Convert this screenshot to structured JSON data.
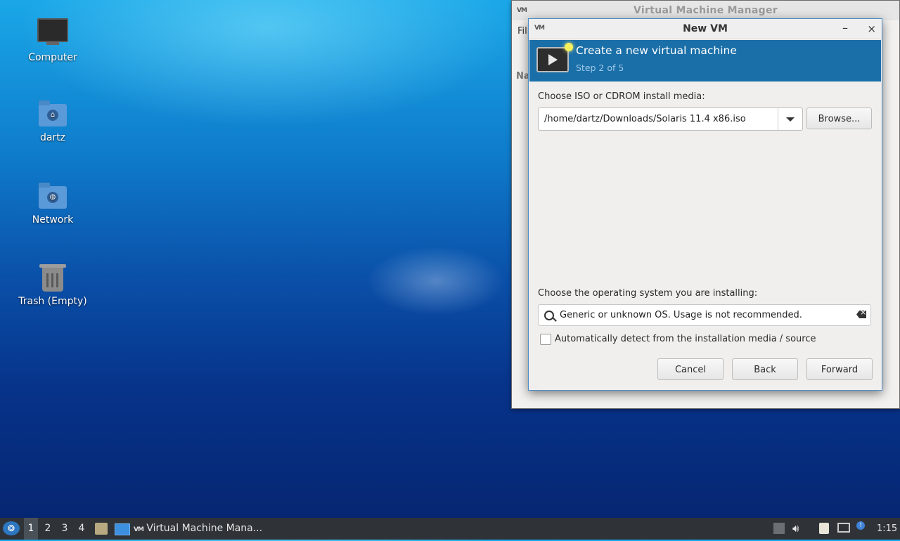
{
  "desktop": {
    "icons": [
      {
        "label": "Computer",
        "icon": "computer-icon"
      },
      {
        "label": "dartz",
        "icon": "home-folder-icon"
      },
      {
        "label": "Network",
        "icon": "network-folder-icon"
      },
      {
        "label": "Trash (Empty)",
        "icon": "trash-icon"
      }
    ]
  },
  "main_window": {
    "title": "Virtual Machine Manager",
    "menu_peek": "Fil",
    "column_peek": "Na"
  },
  "dialog": {
    "title": "New VM",
    "minimize": "–",
    "close": "×",
    "banner": {
      "heading": "Create a new virtual machine",
      "step": "Step 2 of 5"
    },
    "media_label": "Choose ISO or CDROM install media:",
    "media_value": "/home/dartz/Downloads/Solaris 11.4 x86.iso",
    "browse_label": "Browse...",
    "os_label": "Choose the operating system you are installing:",
    "os_value": "Generic or unknown OS. Usage is not recommended.",
    "autodetect_label": "Automatically detect from the installation media / source",
    "autodetect_checked": false,
    "buttons": {
      "cancel": "Cancel",
      "back": "Back",
      "forward": "Forward"
    }
  },
  "taskbar": {
    "workspaces": [
      "1",
      "2",
      "3",
      "4"
    ],
    "active_workspace": "1",
    "task_label": "Virtual Machine Mana...",
    "clock": "1:15",
    "colors": {
      "bar": "#2f3338",
      "banner": "#1a6fa8"
    }
  }
}
